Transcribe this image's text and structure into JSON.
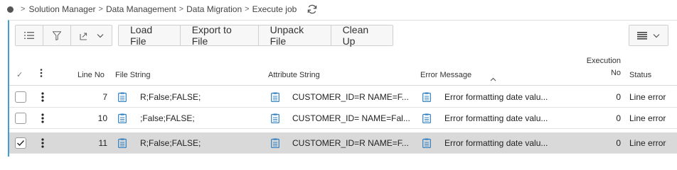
{
  "breadcrumb": {
    "items": [
      "Solution Manager",
      "Data Management",
      "Data Migration",
      "Execute job"
    ]
  },
  "toolbar": {
    "buttons": [
      "Load File",
      "Export to File",
      "Unpack File",
      "Clean Up"
    ]
  },
  "table": {
    "headers": {
      "line_no": "Line No",
      "file_string": "File String",
      "attribute_string": "Attribute String",
      "error_message": "Error Message",
      "execution_no": "Execution No",
      "execution_no_line1": "Execution",
      "execution_no_line2": "No",
      "status": "Status"
    },
    "rows": [
      {
        "line_no": "7",
        "file_string": "R;False;FALSE;",
        "attribute_string": "CUSTOMER_ID=R NAME=F...",
        "error_message": "Error formatting date valu...",
        "execution_no": "0",
        "status": "Line error",
        "selected": false
      },
      {
        "line_no": "10",
        "file_string": ";False;FALSE;",
        "attribute_string": "CUSTOMER_ID= NAME=Fal...",
        "error_message": "Error formatting date valu...",
        "execution_no": "0",
        "status": "Line error",
        "selected": false
      },
      {
        "line_no": "11",
        "file_string": "R;False;FALSE;",
        "attribute_string": "CUSTOMER_ID=R NAME=F...",
        "error_message": "Error formatting date valu...",
        "execution_no": "0",
        "status": "Line error",
        "selected": true
      }
    ]
  },
  "colors": {
    "accent": "#3ea0d0",
    "doc_icon": "#2f7fc1",
    "selected_row": "#d9d9d9"
  }
}
